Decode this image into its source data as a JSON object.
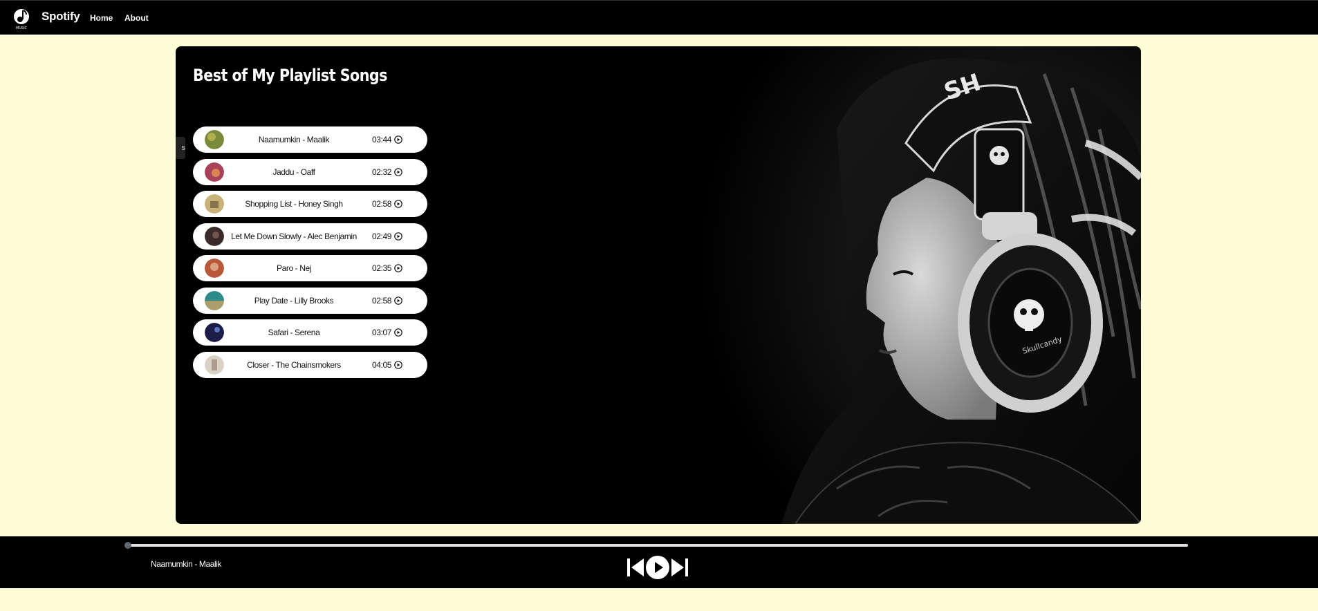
{
  "nav": {
    "brand": "Spotify",
    "links": [
      {
        "label": "Home"
      },
      {
        "label": "About"
      }
    ]
  },
  "main": {
    "title": "Best of My Playlist Songs",
    "side_tab_text": "s",
    "songs": [
      {
        "name": "Naamumkin - Maalik",
        "duration": "03:44",
        "cover_color": "#7a8a3a"
      },
      {
        "name": "Jaddu - Oaff",
        "duration": "02:32",
        "cover_color": "#a8425a"
      },
      {
        "name": "Shopping List - Honey Singh",
        "duration": "02:58",
        "cover_color": "#c9b27a"
      },
      {
        "name": "Let Me Down Slowly - Alec Benjamin",
        "duration": "02:49",
        "cover_color": "#3a2a2a"
      },
      {
        "name": "Paro - Nej",
        "duration": "02:35",
        "cover_color": "#b8583a"
      },
      {
        "name": "Play Date - Lilly Brooks",
        "duration": "02:58",
        "cover_color": "#2c8a8a"
      },
      {
        "name": "Safari - Serena",
        "duration": "03:07",
        "cover_color": "#1d1d4a"
      },
      {
        "name": "Closer - The Chainsmokers",
        "duration": "04:05",
        "cover_color": "#d8d2c4"
      }
    ]
  },
  "player": {
    "now_playing": "Naamumkin - Maalik",
    "progress": 0
  },
  "colors": {
    "page_background": "#fffdd7",
    "bar_background": "#000000",
    "item_background": "#ffffff"
  }
}
